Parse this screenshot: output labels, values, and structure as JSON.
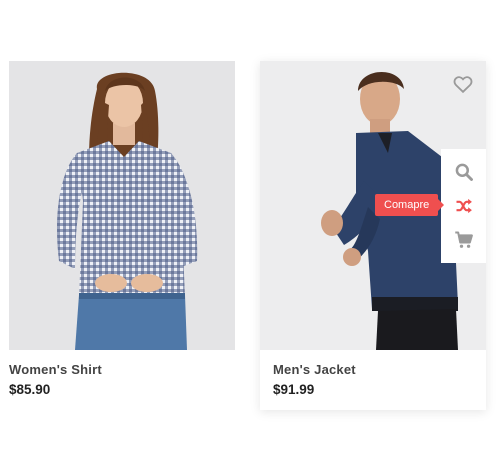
{
  "products": [
    {
      "name": "Women's Shirt",
      "price": "$85.90",
      "image": "woman-plaid-shirt-photo"
    },
    {
      "name": "Men's Jacket",
      "price": "$91.99",
      "image": "man-navy-jacket-photo"
    }
  ],
  "hover_actions": {
    "wishlist_icon": "heart-outline-icon",
    "quick_view_icon": "search-icon",
    "compare_icon": "shuffle-icon",
    "compare_tooltip": "Comapre",
    "cart_icon": "cart-icon"
  },
  "colors": {
    "accent": "#ef4f4f",
    "icon_gray": "#9a9a9a",
    "text_dark": "#222222",
    "text_name": "#444444"
  }
}
